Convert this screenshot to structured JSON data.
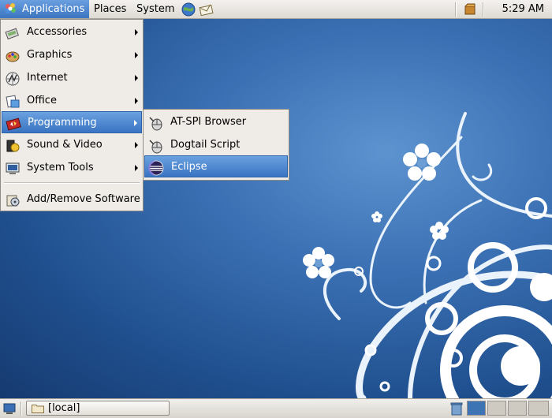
{
  "top_panel": {
    "applications_label": "Applications",
    "places_label": "Places",
    "system_label": "System",
    "clock": "5:29 AM"
  },
  "main_menu": {
    "items": [
      {
        "label": "Accessories",
        "icon": "accessories-icon",
        "submenu": true
      },
      {
        "label": "Graphics",
        "icon": "graphics-icon",
        "submenu": true
      },
      {
        "label": "Internet",
        "icon": "internet-icon",
        "submenu": true
      },
      {
        "label": "Office",
        "icon": "office-icon",
        "submenu": true
      },
      {
        "label": "Programming",
        "icon": "programming-icon",
        "submenu": true,
        "active": true
      },
      {
        "label": "Sound & Video",
        "icon": "sound-video-icon",
        "submenu": true
      },
      {
        "label": "System Tools",
        "icon": "system-tools-icon",
        "submenu": true
      },
      {
        "label": "Add/Remove Software",
        "icon": "add-remove-software-icon",
        "submenu": false
      }
    ]
  },
  "programming_submenu": {
    "items": [
      {
        "label": "AT-SPI Browser",
        "icon": "mouse-icon"
      },
      {
        "label": "Dogtail Script Recorder",
        "icon": "mouse-icon"
      },
      {
        "label": "Eclipse",
        "icon": "eclipse-icon",
        "active": true
      }
    ]
  },
  "bottom_panel": {
    "task_label": "[local]"
  },
  "colors": {
    "highlight": "#3a74c2",
    "panel": "#e8e5e0",
    "desktop": "#2a5da0"
  }
}
